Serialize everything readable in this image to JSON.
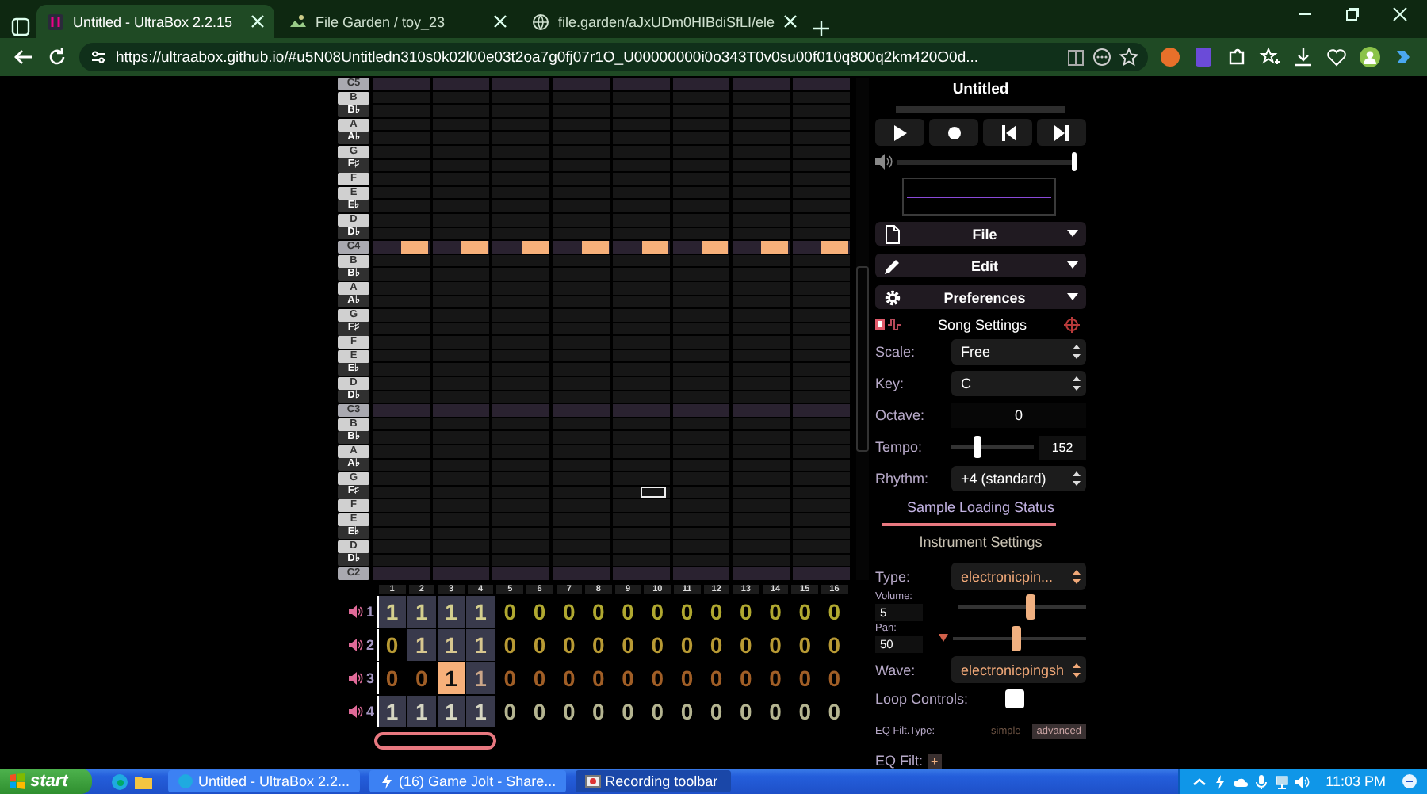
{
  "browser": {
    "tabs": [
      {
        "title": "Untitled - UltraBox 2.2.15",
        "kind": "app",
        "selected": true
      },
      {
        "title": "File Garden / toy_23",
        "kind": "image",
        "selected": false
      },
      {
        "title": "file.garden/aJxUDm0HIBdiSfLI/ele",
        "kind": "globe",
        "selected": false
      }
    ],
    "url": "https://ultraabox.github.io/#u5N08Untitledn310s0k02l00e03t2oa7g0fj07r1O_U00000000i0o343T0v0su00f010q800q2km420O0d..."
  },
  "piano_roll": {
    "keys": [
      {
        "label": "C5",
        "kind": "octave",
        "notes": false,
        "preview": false
      },
      {
        "label": "B",
        "kind": "white",
        "notes": false,
        "preview": false
      },
      {
        "label": "B♭",
        "kind": "black",
        "notes": false,
        "preview": false
      },
      {
        "label": "A",
        "kind": "white",
        "notes": false,
        "preview": false
      },
      {
        "label": "A♭",
        "kind": "black",
        "notes": false,
        "preview": false
      },
      {
        "label": "G",
        "kind": "white",
        "notes": false,
        "preview": false
      },
      {
        "label": "F♯",
        "kind": "black",
        "notes": false,
        "preview": false
      },
      {
        "label": "F",
        "kind": "white",
        "notes": false,
        "preview": false
      },
      {
        "label": "E",
        "kind": "white",
        "notes": false,
        "preview": false
      },
      {
        "label": "E♭",
        "kind": "black",
        "notes": false,
        "preview": false
      },
      {
        "label": "D",
        "kind": "white",
        "notes": false,
        "preview": false
      },
      {
        "label": "D♭",
        "kind": "black",
        "notes": false,
        "preview": false
      },
      {
        "label": "C4",
        "kind": "octave",
        "notes": true,
        "preview": false
      },
      {
        "label": "B",
        "kind": "white",
        "notes": false,
        "preview": false
      },
      {
        "label": "B♭",
        "kind": "black",
        "notes": false,
        "preview": false
      },
      {
        "label": "A",
        "kind": "white",
        "notes": false,
        "preview": false
      },
      {
        "label": "A♭",
        "kind": "black",
        "notes": false,
        "preview": false
      },
      {
        "label": "G",
        "kind": "white",
        "notes": false,
        "preview": false
      },
      {
        "label": "F♯",
        "kind": "black",
        "notes": false,
        "preview": false
      },
      {
        "label": "F",
        "kind": "white",
        "notes": false,
        "preview": false
      },
      {
        "label": "E",
        "kind": "white",
        "notes": false,
        "preview": false
      },
      {
        "label": "E♭",
        "kind": "black",
        "notes": false,
        "preview": false
      },
      {
        "label": "D",
        "kind": "white",
        "notes": false,
        "preview": false
      },
      {
        "label": "D♭",
        "kind": "black",
        "notes": false,
        "preview": false
      },
      {
        "label": "C3",
        "kind": "octave",
        "notes": false,
        "preview": false
      },
      {
        "label": "B",
        "kind": "white",
        "notes": false,
        "preview": false
      },
      {
        "label": "B♭",
        "kind": "black",
        "notes": false,
        "preview": false
      },
      {
        "label": "A",
        "kind": "white",
        "notes": false,
        "preview": false
      },
      {
        "label": "A♭",
        "kind": "black",
        "notes": false,
        "preview": false
      },
      {
        "label": "G",
        "kind": "white",
        "notes": false,
        "preview": false
      },
      {
        "label": "F♯",
        "kind": "black",
        "notes": false,
        "preview": true
      },
      {
        "label": "F",
        "kind": "white",
        "notes": false,
        "preview": false
      },
      {
        "label": "E",
        "kind": "white",
        "notes": false,
        "preview": false
      },
      {
        "label": "E♭",
        "kind": "black",
        "notes": false,
        "preview": false
      },
      {
        "label": "D",
        "kind": "white",
        "notes": false,
        "preview": false
      },
      {
        "label": "D♭",
        "kind": "black",
        "notes": false,
        "preview": false
      },
      {
        "label": "C2",
        "kind": "octave",
        "notes": false,
        "preview": false
      }
    ]
  },
  "pattern": {
    "bars": [
      "1",
      "2",
      "3",
      "4",
      "5",
      "6",
      "7",
      "8",
      "9",
      "10",
      "11",
      "12",
      "13",
      "14",
      "15",
      "16"
    ],
    "channels": [
      {
        "number": "1",
        "color": "#b0a830",
        "cells": [
          {
            "value": "1",
            "kind": "pattern",
            "selected": false
          },
          {
            "value": "1",
            "kind": "pattern",
            "selected": false
          },
          {
            "value": "1",
            "kind": "pattern",
            "selected": false
          },
          {
            "value": "1",
            "kind": "pattern",
            "selected": false
          },
          {
            "value": "0",
            "kind": "empty",
            "selected": false
          },
          {
            "value": "0",
            "kind": "empty",
            "selected": false
          },
          {
            "value": "0",
            "kind": "empty",
            "selected": false
          },
          {
            "value": "0",
            "kind": "empty",
            "selected": false
          },
          {
            "value": "0",
            "kind": "empty",
            "selected": false
          },
          {
            "value": "0",
            "kind": "empty",
            "selected": false
          },
          {
            "value": "0",
            "kind": "empty",
            "selected": false
          },
          {
            "value": "0",
            "kind": "empty",
            "selected": false
          },
          {
            "value": "0",
            "kind": "empty",
            "selected": false
          },
          {
            "value": "0",
            "kind": "empty",
            "selected": false
          },
          {
            "value": "0",
            "kind": "empty",
            "selected": false
          },
          {
            "value": "0",
            "kind": "empty",
            "selected": false
          }
        ]
      },
      {
        "number": "2",
        "color": "#b89a34",
        "cells": [
          {
            "value": "0",
            "kind": "empty",
            "selected": false
          },
          {
            "value": "1",
            "kind": "pattern",
            "selected": false
          },
          {
            "value": "1",
            "kind": "pattern",
            "selected": false
          },
          {
            "value": "1",
            "kind": "pattern",
            "selected": false
          },
          {
            "value": "0",
            "kind": "empty",
            "selected": false
          },
          {
            "value": "0",
            "kind": "empty",
            "selected": false
          },
          {
            "value": "0",
            "kind": "empty",
            "selected": false
          },
          {
            "value": "0",
            "kind": "empty",
            "selected": false
          },
          {
            "value": "0",
            "kind": "empty",
            "selected": false
          },
          {
            "value": "0",
            "kind": "empty",
            "selected": false
          },
          {
            "value": "0",
            "kind": "empty",
            "selected": false
          },
          {
            "value": "0",
            "kind": "empty",
            "selected": false
          },
          {
            "value": "0",
            "kind": "empty",
            "selected": false
          },
          {
            "value": "0",
            "kind": "empty",
            "selected": false
          },
          {
            "value": "0",
            "kind": "empty",
            "selected": false
          },
          {
            "value": "0",
            "kind": "empty",
            "selected": false
          }
        ]
      },
      {
        "number": "3",
        "color": "#a05e26",
        "cells": [
          {
            "value": "0",
            "kind": "empty",
            "selected": false
          },
          {
            "value": "0",
            "kind": "empty",
            "selected": false
          },
          {
            "value": "1",
            "kind": "pattern",
            "selected": true
          },
          {
            "value": "1",
            "kind": "pattern",
            "selected": false
          },
          {
            "value": "0",
            "kind": "empty",
            "selected": false
          },
          {
            "value": "0",
            "kind": "empty",
            "selected": false
          },
          {
            "value": "0",
            "kind": "empty",
            "selected": false
          },
          {
            "value": "0",
            "kind": "empty",
            "selected": false
          },
          {
            "value": "0",
            "kind": "empty",
            "selected": false
          },
          {
            "value": "0",
            "kind": "empty",
            "selected": false
          },
          {
            "value": "0",
            "kind": "empty",
            "selected": false
          },
          {
            "value": "0",
            "kind": "empty",
            "selected": false
          },
          {
            "value": "0",
            "kind": "empty",
            "selected": false
          },
          {
            "value": "0",
            "kind": "empty",
            "selected": false
          },
          {
            "value": "0",
            "kind": "empty",
            "selected": false
          },
          {
            "value": "0",
            "kind": "empty",
            "selected": false
          }
        ]
      },
      {
        "number": "4",
        "color": "#b4b490",
        "cells": [
          {
            "value": "1",
            "kind": "pattern",
            "selected": false
          },
          {
            "value": "1",
            "kind": "pattern",
            "selected": false
          },
          {
            "value": "1",
            "kind": "pattern",
            "selected": false
          },
          {
            "value": "1",
            "kind": "pattern",
            "selected": false
          },
          {
            "value": "0",
            "kind": "empty",
            "selected": false
          },
          {
            "value": "0",
            "kind": "empty",
            "selected": false
          },
          {
            "value": "0",
            "kind": "empty",
            "selected": false
          },
          {
            "value": "0",
            "kind": "empty",
            "selected": false
          },
          {
            "value": "0",
            "kind": "empty",
            "selected": false
          },
          {
            "value": "0",
            "kind": "empty",
            "selected": false
          },
          {
            "value": "0",
            "kind": "empty",
            "selected": false
          },
          {
            "value": "0",
            "kind": "empty",
            "selected": false
          },
          {
            "value": "0",
            "kind": "empty",
            "selected": false
          },
          {
            "value": "0",
            "kind": "empty",
            "selected": false
          },
          {
            "value": "0",
            "kind": "empty",
            "selected": false
          },
          {
            "value": "0",
            "kind": "empty",
            "selected": false
          }
        ]
      }
    ]
  },
  "panel": {
    "title": "Untitled",
    "volume": {
      "level": 1
    },
    "menus": [
      {
        "label": "File",
        "kind": "file"
      },
      {
        "label": "Edit",
        "kind": "edit"
      },
      {
        "label": "Preferences",
        "kind": "preferences"
      }
    ],
    "song_settings": {
      "title": "Song Settings",
      "rows": [
        {
          "kind": "select",
          "label": "Scale:",
          "value": "Free"
        },
        {
          "kind": "select",
          "label": "Key:",
          "value": "C"
        },
        {
          "kind": "number",
          "label": "Octave:",
          "value": "0"
        },
        {
          "kind": "slider",
          "label": "Tempo:",
          "value": "152",
          "level": 0.3
        },
        {
          "kind": "select",
          "label": "Rhythm:",
          "value": "+4 (standard)"
        }
      ]
    },
    "sample_loading": {
      "label": "Sample Loading Status",
      "level": 1
    },
    "instrument_settings": {
      "title": "Instrument Settings",
      "type": {
        "label": "Type:",
        "value": "electronicpin..."
      },
      "volume": {
        "label": "Volume:",
        "value": "5",
        "level": 0.57
      },
      "pan": {
        "label": "Pan:",
        "value": "50",
        "level": 0.47
      },
      "wave": {
        "label": "Wave:",
        "value": "electronicpingsh"
      },
      "loop_controls": {
        "label": "Loop Controls:",
        "checked": false
      },
      "eq_filter_type": {
        "label": "EQ Filt.Type:",
        "options": [
          {
            "label": "simple",
            "selected": false
          },
          {
            "label": "advanced",
            "selected": true
          }
        ]
      },
      "eq_filter": {
        "label": "EQ Filt:",
        "button": "+"
      }
    }
  },
  "taskbar": {
    "start": "start",
    "tasks": [
      {
        "title": "Untitled - UltraBox 2.2...",
        "kind": "browser",
        "selected": false
      },
      {
        "title": "(16) Game Jolt - Share...",
        "kind": "bolt",
        "selected": false
      },
      {
        "title": "Recording toolbar",
        "kind": "recorder",
        "selected": true
      }
    ],
    "clock": "11:03 PM"
  }
}
